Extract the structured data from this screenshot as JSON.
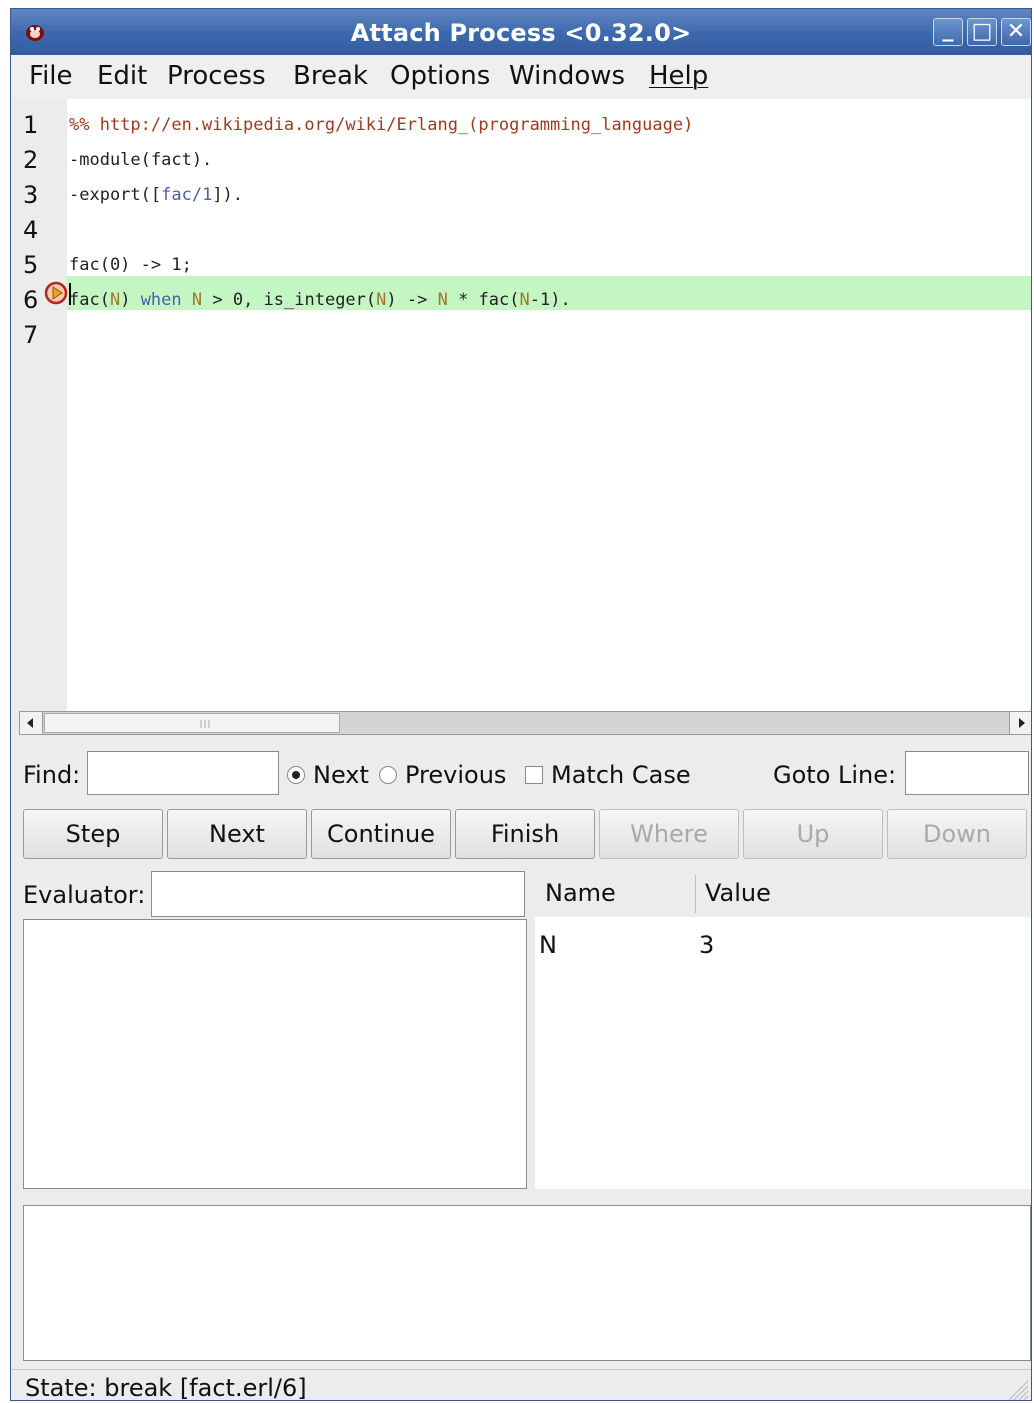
{
  "window": {
    "title": "Attach Process <0.32.0>",
    "controls": [
      "minimize",
      "maximize",
      "close"
    ]
  },
  "menubar": {
    "items": [
      "File",
      "Edit",
      "Process",
      "Break",
      "Options",
      "Windows",
      "Help"
    ]
  },
  "editor": {
    "line_numbers": [
      "1",
      "2",
      "3",
      "4",
      "5",
      "6",
      "7"
    ],
    "lines": [
      {
        "parts": [
          {
            "text": "%% http://en.wikipedia.org/wiki/Erlang_(programming_language)",
            "kind": "comment"
          }
        ]
      },
      {
        "parts": [
          {
            "text": "-module(fact).",
            "kind": "plain"
          }
        ]
      },
      {
        "parts": [
          {
            "text": "-export([",
            "kind": "plain"
          },
          {
            "text": "fac/1",
            "kind": "kw"
          },
          {
            "text": "]).",
            "kind": "plain"
          }
        ]
      },
      {
        "parts": []
      },
      {
        "parts": [
          {
            "text": "fac(0) -> 1;",
            "kind": "plain"
          }
        ]
      },
      {
        "parts": [
          {
            "text": "fac(",
            "kind": "plain"
          },
          {
            "text": "N",
            "kind": "var"
          },
          {
            "text": ") ",
            "kind": "plain"
          },
          {
            "text": "when",
            "kind": "kw"
          },
          {
            "text": " ",
            "kind": "plain"
          },
          {
            "text": "N",
            "kind": "var"
          },
          {
            "text": " > 0, is_integer(",
            "kind": "plain"
          },
          {
            "text": "N",
            "kind": "var"
          },
          {
            "text": ") -> ",
            "kind": "plain"
          },
          {
            "text": "N",
            "kind": "var"
          },
          {
            "text": " * fac(",
            "kind": "plain"
          },
          {
            "text": "N",
            "kind": "var"
          },
          {
            "text": "-1).",
            "kind": "plain"
          }
        ]
      },
      {
        "parts": []
      }
    ],
    "current_line": "6",
    "breakpoint_line": "6",
    "highlight_color": "#c4f6c4",
    "breakpoint_icon": "breakpoint-arrow-icon"
  },
  "find": {
    "label": "Find:",
    "value": "",
    "next_label": "Next",
    "previous_label": "Previous",
    "match_case_label": "Match Case",
    "direction": "Next",
    "match_case": false,
    "goto_label": "Goto Line:",
    "goto_value": ""
  },
  "buttons": {
    "step": "Step",
    "next": "Next",
    "continue": "Continue",
    "finish": "Finish",
    "where": "Where",
    "up": "Up",
    "down": "Down"
  },
  "evaluator": {
    "label": "Evaluator:",
    "value": ""
  },
  "bindings": {
    "headers": [
      "Name",
      "Value"
    ],
    "rows": [
      {
        "name": "N",
        "value": "3"
      }
    ]
  },
  "status": {
    "text": "State: break [fact.erl/6]"
  },
  "colors": {
    "titlebar": "#3d68ad",
    "comment": "#9a3b1e",
    "keyword": "#4a5fa8",
    "variable": "#a07828"
  }
}
